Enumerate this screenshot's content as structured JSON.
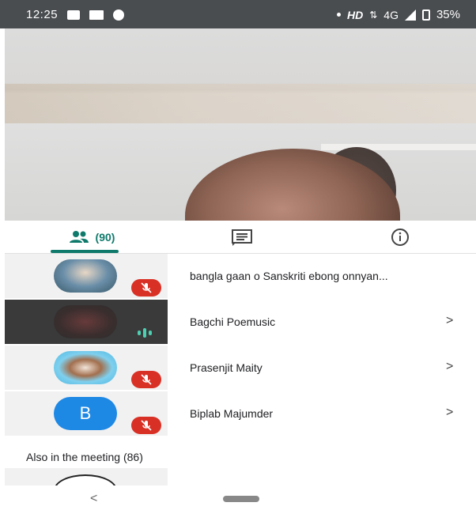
{
  "status_bar": {
    "time": "12:25",
    "network": "HD",
    "signal": "4G",
    "battery": "35%"
  },
  "tabs": {
    "people_count": "(90)"
  },
  "participants": [
    {
      "name": "bangla gaan o Sanskriti ebong onnyan...",
      "muted": true,
      "speaking": false,
      "has_chevron": false
    },
    {
      "name": "Bagchi Poemusic",
      "muted": false,
      "speaking": true,
      "has_chevron": true
    },
    {
      "name": "Prasenjit Maity",
      "muted": true,
      "speaking": false,
      "has_chevron": true
    },
    {
      "name": "Biplab Majumder",
      "muted": true,
      "speaking": false,
      "has_chevron": true,
      "avatar_letter": "B"
    }
  ],
  "chevron": ">",
  "section": {
    "also_in_meeting": "Also in the meeting (86)"
  },
  "nav": {
    "back": "<"
  },
  "colors": {
    "accent": "#0f7a6b",
    "mute": "#d93025",
    "speaking": "#4dd0b1",
    "status_bar": "#4a4d50"
  }
}
